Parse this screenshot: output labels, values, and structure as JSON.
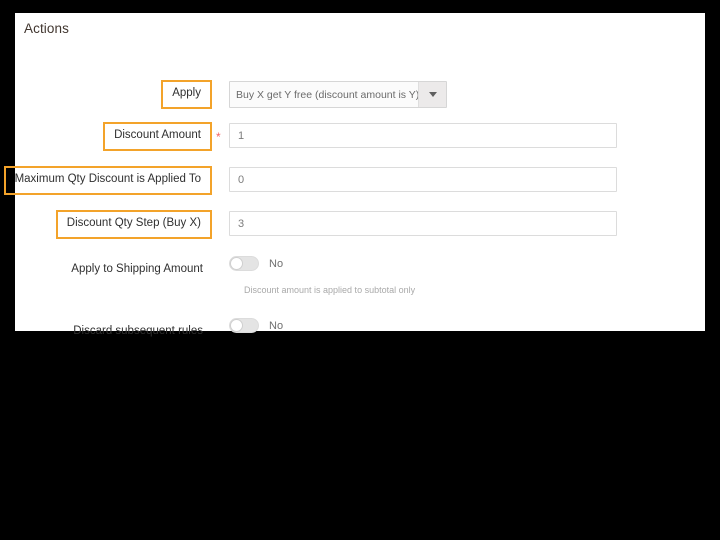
{
  "panel": {
    "title": "Actions"
  },
  "form": {
    "rows": [
      {
        "name": "apply",
        "label": "Apply",
        "highlighted": true,
        "required": false,
        "control": "select",
        "value": "Buy X get Y free (discount amount is Y)"
      },
      {
        "name": "discount-amount",
        "label": "Discount Amount",
        "highlighted": true,
        "required": true,
        "control": "text",
        "value": "1"
      },
      {
        "name": "maximum-qty-discount-is-applied-to",
        "label": "Maximum Qty Discount is Applied To",
        "highlighted": true,
        "required": false,
        "control": "text",
        "value": "0"
      },
      {
        "name": "discount-qty-step-buy-x",
        "label": "Discount Qty Step (Buy X)",
        "highlighted": true,
        "required": false,
        "control": "text",
        "value": "3"
      },
      {
        "name": "apply-to-shipping-amount",
        "label": "Apply to Shipping Amount",
        "highlighted": false,
        "required": false,
        "control": "toggle",
        "value": "No",
        "note": "Discount amount is applied to subtotal only"
      },
      {
        "name": "discard-subsequent-rules",
        "label": "Discard subsequent rules",
        "highlighted": false,
        "required": false,
        "control": "toggle",
        "value": "No"
      }
    ],
    "required_marker": "*"
  },
  "colors": {
    "highlight": "#f3a32a",
    "required": "#f46363",
    "panel_bg": "#ffffff",
    "page_bg": "#000000",
    "label_text": "#303030"
  }
}
